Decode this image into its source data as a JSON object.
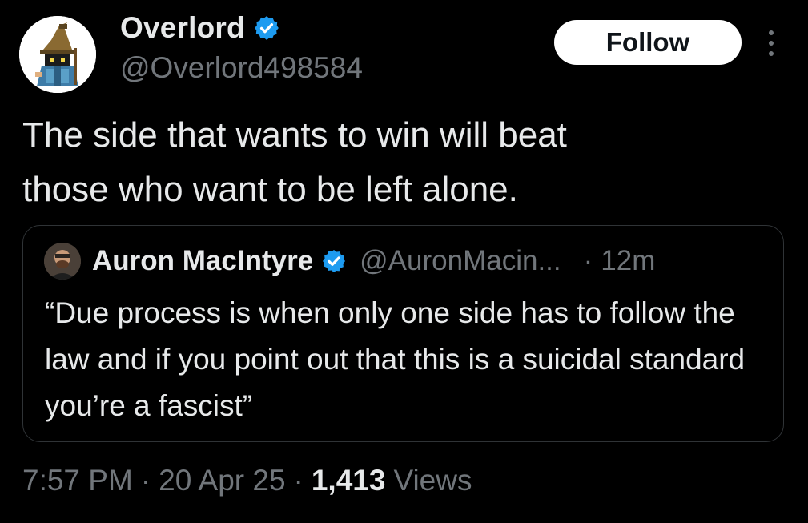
{
  "author": {
    "display_name": "Overlord",
    "handle": "@Overlord498584",
    "verified_icon": "verified-badge-icon"
  },
  "actions": {
    "follow_label": "Follow",
    "more_icon": "more-options-icon"
  },
  "tweet": {
    "text": "The side that wants to win will beat\nthose who want to be left alone."
  },
  "quote": {
    "display_name": "Auron MacIntyre",
    "handle": "@AuronMacin...",
    "separator": "·",
    "time": "12m",
    "text": "“Due process is when only one side has to follow the law and if you point out that this is a suicidal standard you’re a fascist”"
  },
  "meta": {
    "time": "7:57 PM",
    "dot1": "·",
    "date": "20 Apr 25",
    "dot2": "·",
    "views_count": "1,413",
    "views_label": "Views"
  },
  "colors": {
    "background": "#000000",
    "text_primary": "#e7e9ea",
    "text_secondary": "#71767b",
    "verified_blue": "#1d9bf0",
    "border": "#2f3336"
  }
}
